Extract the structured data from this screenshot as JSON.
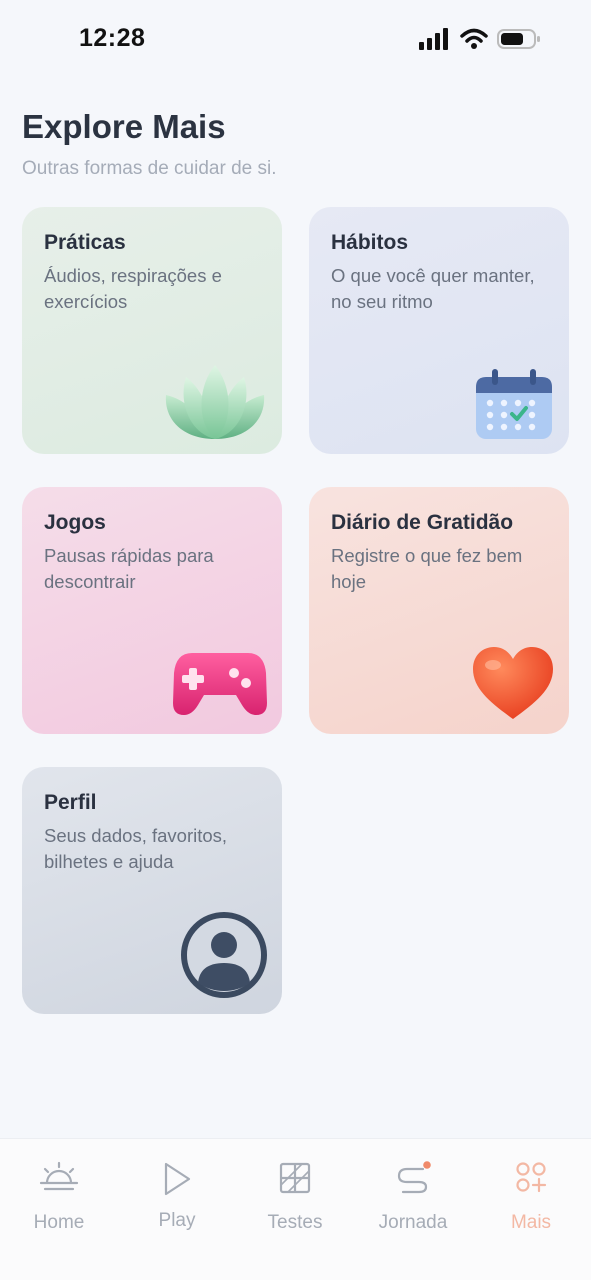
{
  "status_bar": {
    "time": "12:28"
  },
  "header": {
    "title": "Explore Mais",
    "subtitle": "Outras formas de cuidar de si."
  },
  "cards": [
    {
      "title": "Práticas",
      "description": "Áudios, respirações e exercícios",
      "icon": "lotus-icon"
    },
    {
      "title": "Hábitos",
      "description": "O que você quer manter, no seu ritmo",
      "icon": "calendar-icon"
    },
    {
      "title": "Jogos",
      "description": "Pausas rápidas para descontrair",
      "icon": "gamepad-icon"
    },
    {
      "title": "Diário de Gratidão",
      "description": "Registre o que fez bem hoje",
      "icon": "heart-icon"
    },
    {
      "title": "Perfil",
      "description": "Seus dados, favoritos, bilhetes e ajuda",
      "icon": "profile-icon"
    }
  ],
  "bottom_nav": {
    "items": [
      {
        "label": "Home",
        "icon": "sunrise-icon"
      },
      {
        "label": "Play",
        "icon": "play-icon"
      },
      {
        "label": "Testes",
        "icon": "grid-icon"
      },
      {
        "label": "Jornada",
        "icon": "path-icon"
      },
      {
        "label": "Mais",
        "icon": "apps-plus-icon"
      }
    ],
    "active": "Mais"
  },
  "colors": {
    "background": "#f5f7fb",
    "active_nav": "#f3b8a4",
    "inactive_nav": "#a6acb6",
    "notification_dot": "#f08a6a"
  }
}
